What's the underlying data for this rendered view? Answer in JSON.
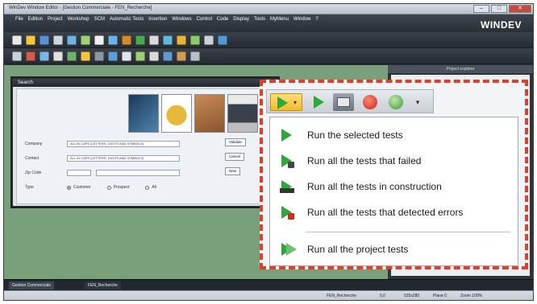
{
  "window": {
    "title": "WinDev  Window Editor - [Gestion Commerciale - FEN_Recherche]",
    "controls": [
      "–",
      "□",
      "✕"
    ]
  },
  "menubar": {
    "items": [
      "File",
      "Edition",
      "Project",
      "Workshop",
      "SCM",
      "Automatic Tests",
      "Insertion",
      "Windows",
      "Control",
      "Code",
      "Display",
      "Tools",
      "MyMenu",
      "Window",
      "?"
    ],
    "brand": "WINDEV"
  },
  "right_panel": {
    "title": "Project explorer"
  },
  "form": {
    "title": "Search",
    "company_label": "Company",
    "company_value": "ALL IN CAPS (LETTERS, DIGITS AND SYMBOLS)",
    "contact_label": "Contact",
    "contact_value": "ALL IN CAPS (LETTERS, DIGITS AND SYMBOLS)",
    "zip_label": "Zip Code",
    "type_label": "Type",
    "radios": [
      "Customer",
      "Prospect",
      "All"
    ],
    "validate_label": "Validate",
    "cancel_label": "Cancel",
    "new_label": "New"
  },
  "tests_menu": {
    "items": [
      {
        "label": "Run the selected tests",
        "icon": "play-icon"
      },
      {
        "label": "Run all the tests that failed",
        "icon": "play-failed-icon"
      },
      {
        "label": "Run all the tests in construction",
        "icon": "play-construction-icon"
      },
      {
        "label": "Run all the tests that detected errors",
        "icon": "play-errors-icon"
      },
      {
        "label": "Run all the project tests",
        "icon": "play-project-icon"
      }
    ]
  },
  "doc_tabs": [
    "Gestion Commerciale",
    "FEN_Recherche"
  ],
  "status": {
    "window": "FEN_Recherche",
    "coords": "0,0",
    "size": "525x280",
    "plane": "Plane 0",
    "zoom": "Zoom 100%"
  },
  "colors": {
    "accent_red": "#e53e27",
    "run_green": "#2ea83a",
    "workarea_green": "#78a07a"
  }
}
